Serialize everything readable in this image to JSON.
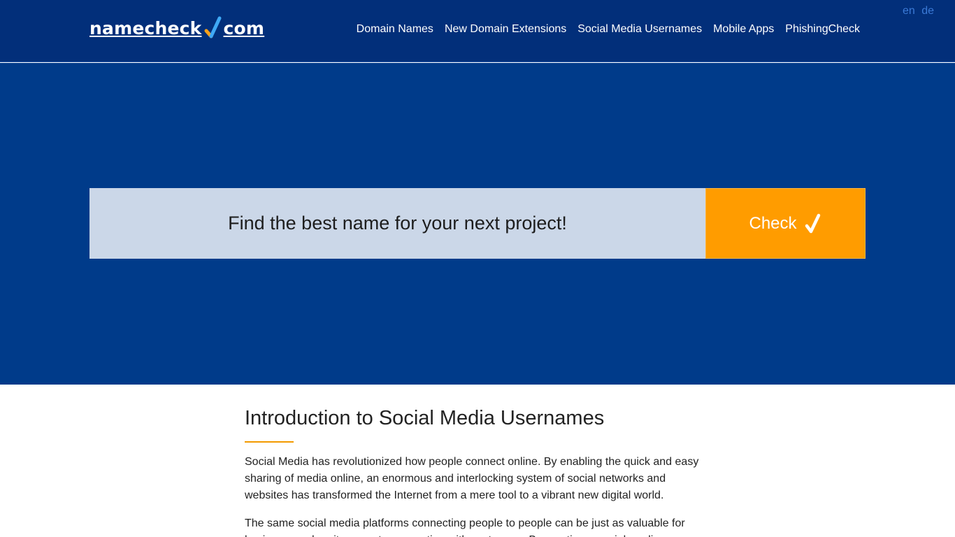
{
  "header": {
    "logo": {
      "name": "namecheck",
      "tld": "com",
      "icon": "checkmark-icon"
    },
    "nav": [
      {
        "label": "Domain Names"
      },
      {
        "label": "New Domain Extensions"
      },
      {
        "label": "Social Media Usernames"
      },
      {
        "label": "Mobile Apps"
      },
      {
        "label": "PhishingCheck"
      }
    ],
    "languages": [
      "en",
      "de"
    ]
  },
  "hero": {
    "search": {
      "placeholder": "Find the best name for your next project!",
      "value": ""
    },
    "check_button": {
      "label": "Check",
      "icon": "checkmark-icon"
    }
  },
  "content": {
    "title": "Introduction to Social Media Usernames",
    "paragraphs": [
      "Social Media has revolutionized how people connect online. By enabling the quick and easy sharing of media online, an enormous and interlocking system of social networks and websites has transformed the Internet from a mere tool to a vibrant new digital world.",
      "The same social media platforms connecting people to people can be just as valuable for businesses when it comes to connecting with customers. By creating a social media"
    ]
  },
  "colors": {
    "header_bg": "#022f7a",
    "hero_bg": "#003b8a",
    "accent": "#ff9c00",
    "search_bg": "#cbd7e8"
  }
}
